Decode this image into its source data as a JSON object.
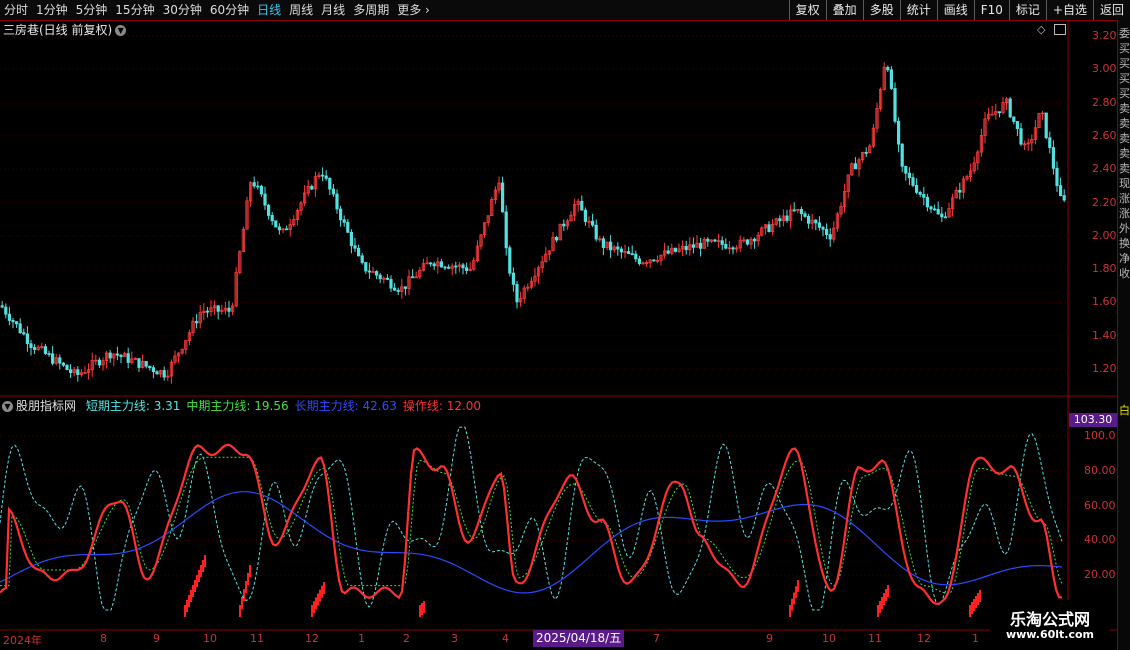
{
  "toolbar": {
    "periods": [
      "分时",
      "1分钟",
      "5分钟",
      "15分钟",
      "30分钟",
      "60分钟",
      "日线",
      "周线",
      "月线",
      "多周期",
      "更多"
    ],
    "active_period": "日线",
    "right_buttons": [
      "复权",
      "叠加",
      "多股",
      "统计",
      "画线",
      "F10",
      "标记",
      "+自选",
      "返回"
    ]
  },
  "main_pane": {
    "title": "三房巷(日线 前复权)",
    "price_labels": [
      "3.20",
      "3.00",
      "2.80",
      "2.60",
      "2.40",
      "2.20",
      "2.00",
      "1.80",
      "1.60",
      "1.40",
      "1.20"
    ],
    "colors": {
      "up": "#ff3b3b",
      "down": "#54e0e0"
    }
  },
  "indicator_pane": {
    "name": "股朋指标网",
    "lines": [
      {
        "label": "短期主力线:",
        "value": "3.31",
        "color": "#53e5e5"
      },
      {
        "label": "中期主力线:",
        "value": "19.56",
        "color": "#40e040"
      },
      {
        "label": "长期主力线:",
        "value": "42.63",
        "color": "#2a4bff"
      },
      {
        "label": "操作线:",
        "value": "12.00",
        "color": "#ff3030"
      }
    ],
    "current_badge": "103.30",
    "scale_labels": [
      "100.0",
      "80.00",
      "60.00",
      "40.00",
      "20.00"
    ]
  },
  "x_axis": {
    "labels": [
      "2024年",
      "8",
      "9",
      "10",
      "11",
      "12",
      "1",
      "2",
      "3",
      "4",
      "7",
      "9",
      "10",
      "11",
      "12",
      "1"
    ],
    "highlight_date": "2025/04/18/五"
  },
  "side_panel": {
    "chars": [
      "委",
      "买",
      "买",
      "买",
      "买",
      "卖",
      "卖",
      "卖",
      "卖",
      "卖",
      "现",
      "涨",
      "涨",
      "外",
      "换",
      "净",
      "收"
    ],
    "bottom": "白"
  },
  "watermark": {
    "line1": "乐淘公式网",
    "line2": "www.60lt.com"
  }
}
